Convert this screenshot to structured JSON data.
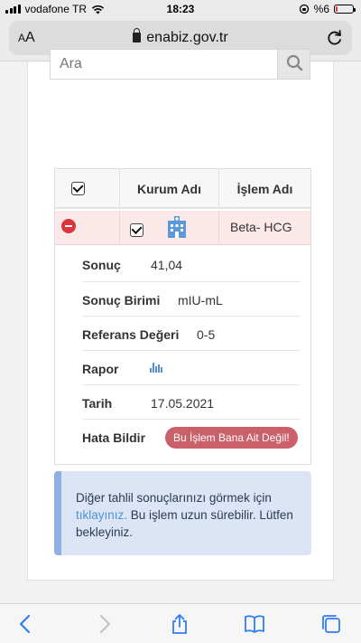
{
  "status_bar": {
    "carrier": "vodafone TR",
    "time": "18:23",
    "battery_percent": "%6",
    "battery_level": 0.06,
    "battery_color": "#e53935"
  },
  "browser": {
    "text_size_label": "AA",
    "url": "enabiz.gov.tr",
    "icons": [
      "lock-icon",
      "reload-icon"
    ]
  },
  "search": {
    "placeholder": "Ara",
    "icon": "search-icon"
  },
  "table": {
    "headers": {
      "checkbox_checked": true,
      "kurum": "Kurum Adı",
      "islem": "İşlem Adı"
    },
    "row": {
      "checked": true,
      "kurum_icon": "hospital-icon",
      "islem": "Beta- HCG"
    },
    "details": {
      "sonuc_label": "Sonuç",
      "sonuc_value": "41,04",
      "birim_label": "Sonuç Birimi",
      "birim_value": "mIU-mL",
      "referans_label": "Referans Değeri",
      "referans_value": "0-5",
      "rapor_label": "Rapor",
      "rapor_icon": "bar-chart-icon",
      "tarih_label": "Tarih",
      "tarih_value": "17.05.2021",
      "hata_label": "Hata Bildir",
      "hata_button": "Bu İşlem Bana Ait Değil!"
    }
  },
  "info": {
    "text_before": "Diğer tahlil sonuçlarınızı görmek için",
    "link": "tıklayınız.",
    "text_after": "Bu işlem uzun sürebilir. Lütfen bekleyiniz."
  },
  "colors": {
    "accent": "#4e93d6",
    "danger": "#d9363e",
    "row_highlight": "#fbe9ea",
    "info_bg": "#dce5f6"
  },
  "toolbar": {
    "icons": [
      "back-icon",
      "forward-icon",
      "share-icon",
      "bookmarks-icon",
      "tabs-icon"
    ]
  }
}
